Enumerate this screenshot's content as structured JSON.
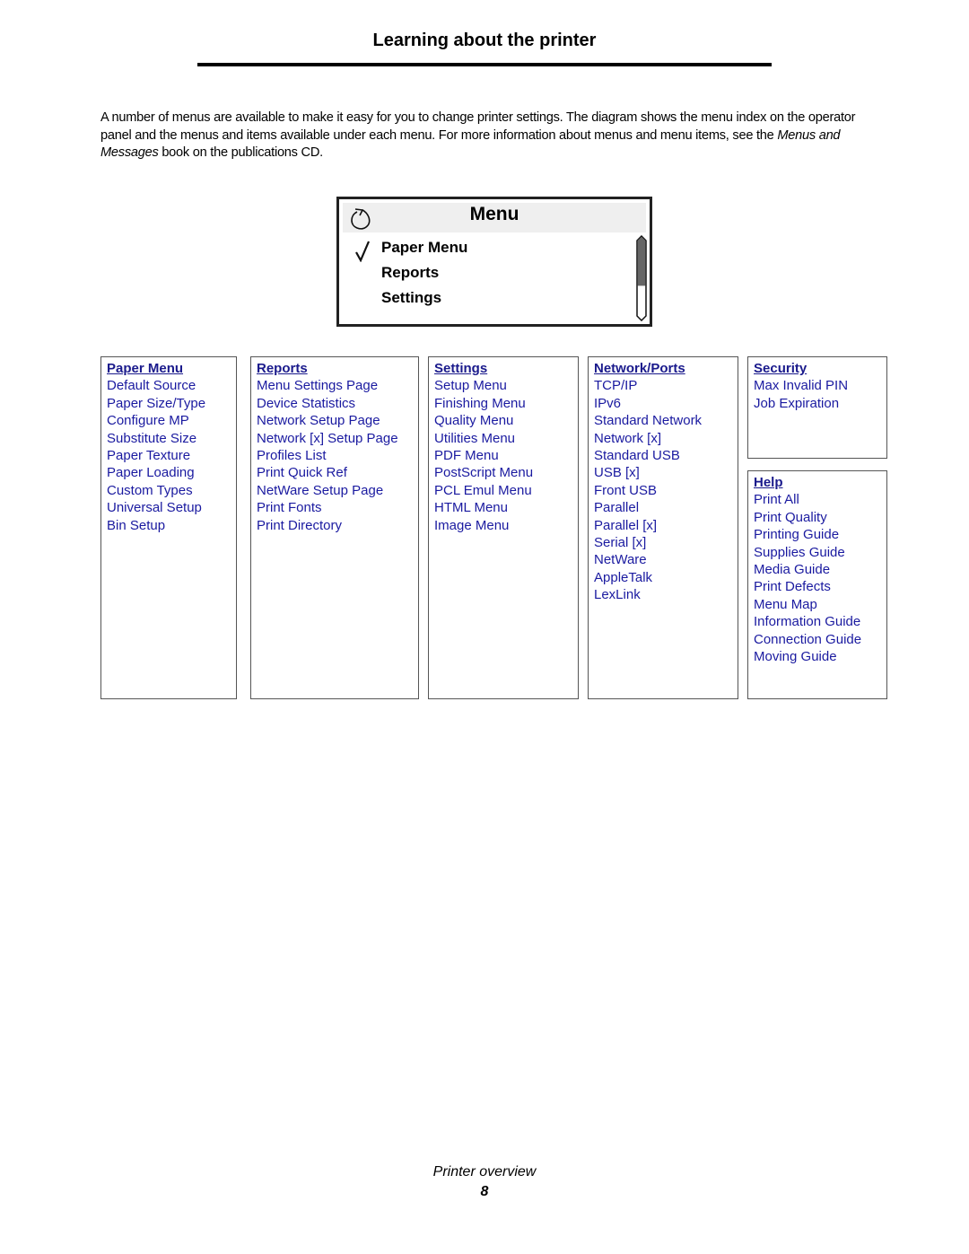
{
  "page": {
    "title": "Learning about the printer",
    "intro_before": "A number of menus are available to make it easy for you to change printer settings. The diagram shows the menu index on the operator panel and the menus and items available under each menu. For more information about menus and menu items, see the ",
    "intro_em": "Menus and Messages",
    "intro_after": " book on the publications CD."
  },
  "panel": {
    "title": "Menu",
    "back_icon": "back-arrow-icon",
    "check_icon": "checkmark-icon",
    "items": [
      "Paper Menu",
      "Reports",
      "Settings"
    ],
    "selected_index": 0,
    "scroll_position_fraction": 0.6
  },
  "menus": [
    {
      "heading": "Paper Menu",
      "items": [
        "Default Source",
        "Paper Size/Type",
        "Configure MP",
        "Substitute Size",
        "Paper Texture",
        "Paper Loading",
        "Custom Types",
        "Universal Setup",
        "Bin Setup"
      ]
    },
    {
      "heading": "Reports",
      "items": [
        "Menu Settings Page",
        "Device Statistics",
        "Network Setup Page",
        "Network [x] Setup Page",
        "Profiles List",
        "Print Quick Ref",
        "NetWare Setup Page",
        "Print Fonts",
        "Print Directory"
      ]
    },
    {
      "heading": "Settings",
      "items": [
        "Setup Menu",
        "Finishing Menu",
        "Quality Menu",
        "Utilities Menu",
        "PDF Menu",
        "PostScript Menu",
        "PCL Emul Menu",
        "HTML Menu",
        "Image Menu"
      ]
    },
    {
      "heading": "Network/Ports",
      "items": [
        "TCP/IP",
        "IPv6",
        "Standard Network",
        "Network [x]",
        "Standard USB",
        "USB [x]",
        "Front USB",
        "Parallel",
        "Parallel [x]",
        "Serial [x]",
        "NetWare",
        "AppleTalk",
        "LexLink"
      ]
    },
    {
      "heading": "Security",
      "items": [
        "Max Invalid PIN",
        "Job Expiration"
      ]
    },
    {
      "heading": "Help",
      "items": [
        "Print All",
        "Print Quality",
        "Printing Guide",
        "Supplies Guide",
        "Media Guide",
        "Print Defects",
        "Menu Map",
        "Information Guide",
        "Connection Guide",
        "Moving Guide"
      ]
    }
  ],
  "footer": {
    "section": "Printer overview",
    "page_number": "8"
  }
}
